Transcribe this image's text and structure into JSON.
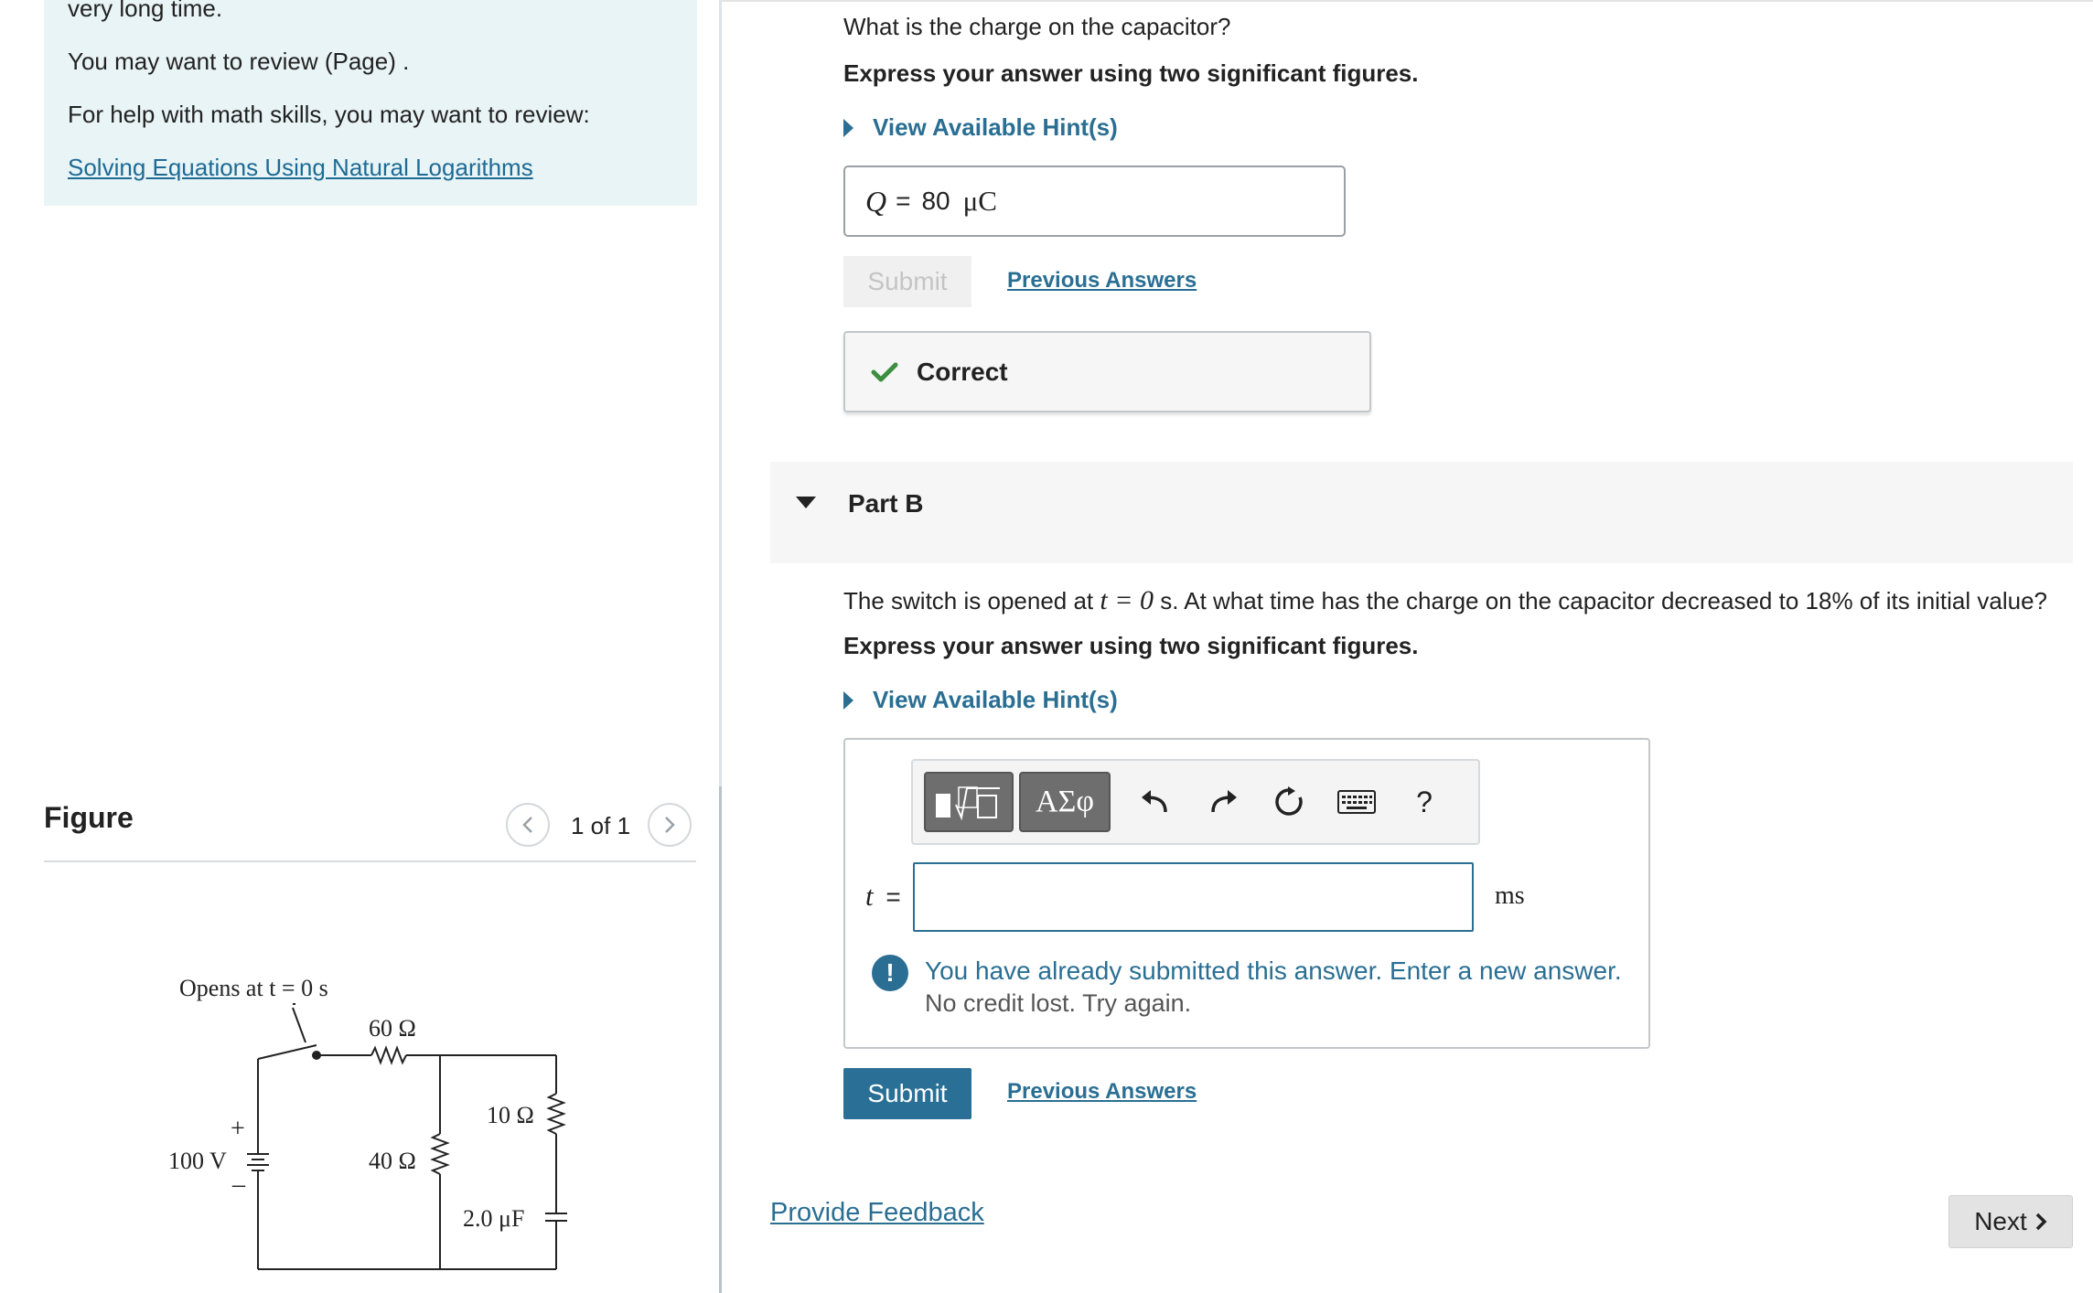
{
  "left": {
    "intro_cut": "very long time.",
    "review_text": "You may want to review (Page) .",
    "math_help": "For help with math skills, you may want to review:",
    "math_link": "Solving Equations Using Natural Logarithms",
    "figure_title": "Figure",
    "pager": "1 of 1",
    "circuit": {
      "switch_label": "Opens at t = 0 s",
      "r1": "60 Ω",
      "r2": "40 Ω",
      "r3": "10 Ω",
      "cap": "2.0 μF",
      "emf": "100 V",
      "plus": "+",
      "minus": "–"
    }
  },
  "part_a": {
    "question": "What is the charge on the capacitor?",
    "instruction": "Express your answer using two significant figures.",
    "hint_label": "View Available Hint(s)",
    "var": "Q",
    "equals": "=",
    "value": "80",
    "unit": "μC",
    "submit_label": "Submit",
    "prev_answers": "Previous Answers",
    "result_label": "Correct"
  },
  "part_b": {
    "title": "Part B",
    "question_pre": "The switch is opened at",
    "question_math": "t = 0",
    "question_post": "s. At what time has the charge on the capacitor decreased to 18% of its initial value?",
    "instruction": "Express your answer using two significant figures.",
    "hint_label": "View Available Hint(s)",
    "toolbar": {
      "templates_glyph": "√□",
      "greek_label": "ΑΣφ",
      "help_label": "?"
    },
    "var": "t",
    "equals": "=",
    "input_value": "",
    "unit": "ms",
    "warning_line1": "You have already submitted this answer. Enter a new answer.",
    "warning_line2": "No credit lost. Try again.",
    "warn_symbol": "!",
    "submit_label": "Submit",
    "prev_answers": "Previous Answers"
  },
  "footer": {
    "feedback": "Provide Feedback",
    "next": "Next"
  },
  "colors": {
    "accent": "#2a6f93",
    "correct_green": "#3b8f3e",
    "intro_bg": "#e9f4f6"
  }
}
